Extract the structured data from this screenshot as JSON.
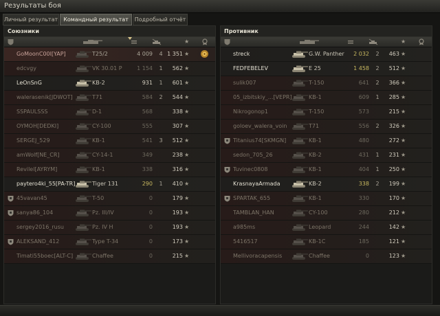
{
  "window": {
    "title": "Результаты боя"
  },
  "tabs": [
    {
      "label": "Личный результат",
      "active": false
    },
    {
      "label": "Командный результат",
      "active": true
    },
    {
      "label": "Подробный отчёт",
      "active": false
    }
  ],
  "allies": {
    "title": "Союзники",
    "rows": [
      {
        "name": "GoMoonC00l[YAP]",
        "tank": "T25/2",
        "dmg": "4 009",
        "kills": "4",
        "xp": "1 351",
        "state": "player",
        "medal": "gear-medal"
      },
      {
        "name": "edcvgy",
        "tank": "VK 30.01 P",
        "dmg": "1 154",
        "kills": "1",
        "xp": "562",
        "state": "dead"
      },
      {
        "name": "LeOnSnG",
        "tank": "KB-2",
        "dmg": "931",
        "kills": "1",
        "xp": "601",
        "state": "alive",
        "dmgClass": "mid"
      },
      {
        "name": "walerasenik[JDWOT]",
        "tank": "T71",
        "dmg": "584",
        "kills": "2",
        "xp": "544",
        "state": "dead"
      },
      {
        "name": "SSPAULSSS",
        "tank": "D-1",
        "dmg": "568",
        "kills": "",
        "xp": "338",
        "state": "dead"
      },
      {
        "name": "OYMOH[DEDKI]",
        "tank": "CY-100",
        "dmg": "555",
        "kills": "",
        "xp": "307",
        "state": "dead"
      },
      {
        "name": "SERGEJ_529",
        "tank": "KB-1",
        "dmg": "541",
        "kills": "3",
        "xp": "512",
        "state": "dead"
      },
      {
        "name": "amWolf[NE_CR]",
        "tank": "CY-14-1",
        "dmg": "349",
        "kills": "",
        "xp": "238",
        "state": "dead"
      },
      {
        "name": "Revilel[AYRYM]",
        "tank": "KB-1",
        "dmg": "338",
        "kills": "",
        "xp": "316",
        "state": "dead"
      },
      {
        "name": "paytero4ki_55[PA-TR]",
        "tank": "Tiger 131",
        "dmg": "290",
        "kills": "1",
        "xp": "410",
        "state": "alive",
        "dmgClass": "hi"
      },
      {
        "name": "45vavan45",
        "tank": "T-50",
        "dmg": "0",
        "kills": "",
        "xp": "179",
        "state": "dead",
        "squad": true
      },
      {
        "name": "sanya86_104",
        "tank": "Pz. III/IV",
        "dmg": "0",
        "kills": "",
        "xp": "193",
        "state": "dead",
        "squad": true
      },
      {
        "name": "sergey2016_rusu",
        "tank": "Pz. IV H",
        "dmg": "0",
        "kills": "",
        "xp": "193",
        "state": "dead"
      },
      {
        "name": "ALEKSAND_412",
        "tank": "Type T-34",
        "dmg": "0",
        "kills": "",
        "xp": "173",
        "state": "dead",
        "squad": true
      },
      {
        "name": "Timati55boec[ALT-C]",
        "tank": "Chaffee",
        "dmg": "0",
        "kills": "",
        "xp": "215",
        "state": "dead"
      }
    ]
  },
  "enemies": {
    "title": "Противник",
    "rows": [
      {
        "name": "streck",
        "tank": "G.W. Panther",
        "dmg": "2 032",
        "kills": "2",
        "xp": "463",
        "state": "alive",
        "dmgClass": "hi"
      },
      {
        "name": "FEDFEBELEV",
        "tank": "E 25",
        "dmg": "1 458",
        "kills": "2",
        "xp": "512",
        "state": "alive",
        "dmgClass": "hi"
      },
      {
        "name": "sulik007",
        "tank": "T-150",
        "dmg": "641",
        "kills": "2",
        "xp": "366",
        "state": "dead"
      },
      {
        "name": "05_izbitskiy_...[VEPR]",
        "tank": "KB-1",
        "dmg": "609",
        "kills": "1",
        "xp": "285",
        "state": "dead"
      },
      {
        "name": "Nikrogonop1",
        "tank": "T-150",
        "dmg": "573",
        "kills": "",
        "xp": "215",
        "state": "dead"
      },
      {
        "name": "goloev_walera_voin",
        "tank": "T71",
        "dmg": "556",
        "kills": "2",
        "xp": "326",
        "state": "dead"
      },
      {
        "name": "Titanius74[SKMGN]",
        "tank": "KB-1",
        "dmg": "480",
        "kills": "",
        "xp": "272",
        "state": "dead",
        "squad": true
      },
      {
        "name": "sedon_705_26",
        "tank": "KB-2",
        "dmg": "431",
        "kills": "1",
        "xp": "231",
        "state": "dead"
      },
      {
        "name": "Tuvinec0808",
        "tank": "KB-1",
        "dmg": "404",
        "kills": "1",
        "xp": "250",
        "state": "dead",
        "squad": true
      },
      {
        "name": "KrasnayaArmada",
        "tank": "KB-2",
        "dmg": "338",
        "kills": "2",
        "xp": "199",
        "state": "alive",
        "dmgClass": "hi"
      },
      {
        "name": "SPARTAK_655",
        "tank": "KB-1",
        "dmg": "330",
        "kills": "",
        "xp": "170",
        "state": "dead",
        "squad": true
      },
      {
        "name": "TAMBLAN_HAN",
        "tank": "CY-100",
        "dmg": "280",
        "kills": "",
        "xp": "212",
        "state": "dead"
      },
      {
        "name": "a985ms",
        "tank": "Leopard",
        "dmg": "244",
        "kills": "",
        "xp": "142",
        "state": "dead"
      },
      {
        "name": "5416517",
        "tank": "KB-1C",
        "dmg": "185",
        "kills": "",
        "xp": "121",
        "state": "dead"
      },
      {
        "name": "Mellivoracapensis",
        "tank": "Chaffee",
        "dmg": "0",
        "kills": "",
        "xp": "123",
        "state": "dead"
      }
    ]
  },
  "colors": {
    "highlight": "#c8b860",
    "player_row": "#3a2622",
    "dead_row": "#271b19"
  }
}
